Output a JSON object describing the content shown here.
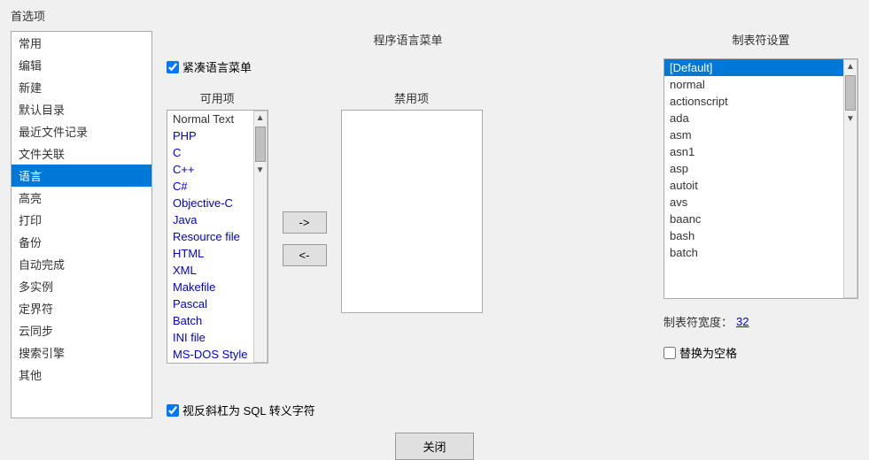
{
  "title": "首选项",
  "sidebar": {
    "items": [
      {
        "label": "常用",
        "active": false
      },
      {
        "label": "编辑",
        "active": false
      },
      {
        "label": "新建",
        "active": false
      },
      {
        "label": "默认目录",
        "active": false
      },
      {
        "label": "最近文件记录",
        "active": false
      },
      {
        "label": "文件关联",
        "active": false
      },
      {
        "label": "语言",
        "active": true
      },
      {
        "label": "高亮",
        "active": false
      },
      {
        "label": "打印",
        "active": false
      },
      {
        "label": "备份",
        "active": false
      },
      {
        "label": "自动完成",
        "active": false
      },
      {
        "label": "多实例",
        "active": false
      },
      {
        "label": "定界符",
        "active": false
      },
      {
        "label": "云同步",
        "active": false
      },
      {
        "label": "搜索引擎",
        "active": false
      },
      {
        "label": "其他",
        "active": false
      }
    ]
  },
  "center": {
    "panel_title": "程序语言菜单",
    "compact_lang_label": "紧凑语言菜单",
    "compact_lang_checked": true,
    "available_title": "可用项",
    "disabled_title": "禁用项",
    "arrow_right": "->",
    "arrow_left": "<-",
    "available_items": [
      {
        "label": "Normal Text",
        "colored": false
      },
      {
        "label": "PHP",
        "colored": true
      },
      {
        "label": "C",
        "colored": true
      },
      {
        "label": "C++",
        "colored": true
      },
      {
        "label": "C#",
        "colored": true
      },
      {
        "label": "Objective-C",
        "colored": true
      },
      {
        "label": "Java",
        "colored": true
      },
      {
        "label": "Resource file",
        "colored": true
      },
      {
        "label": "HTML",
        "colored": true
      },
      {
        "label": "XML",
        "colored": true
      },
      {
        "label": "Makefile",
        "colored": true
      },
      {
        "label": "Pascal",
        "colored": true
      },
      {
        "label": "Batch",
        "colored": true
      },
      {
        "label": "INI file",
        "colored": true
      },
      {
        "label": "MS-DOS Style",
        "colored": true
      }
    ],
    "sql_checkbox_label": "视反斜杠为 SQL 转义字符",
    "sql_checkbox_checked": true
  },
  "right": {
    "panel_title": "制表符设置",
    "list_items": [
      {
        "label": "[Default]",
        "selected": true
      },
      {
        "label": "normal",
        "selected": false
      },
      {
        "label": "actionscript",
        "selected": false
      },
      {
        "label": "ada",
        "selected": false
      },
      {
        "label": "asm",
        "selected": false
      },
      {
        "label": "asn1",
        "selected": false
      },
      {
        "label": "asp",
        "selected": false
      },
      {
        "label": "autoit",
        "selected": false
      },
      {
        "label": "avs",
        "selected": false
      },
      {
        "label": "baanc",
        "selected": false
      },
      {
        "label": "bash",
        "selected": false
      },
      {
        "label": "batch",
        "selected": false
      }
    ],
    "tab_width_label": "制表符宽度：",
    "tab_width_value": "32",
    "replace_checkbox_label": "替换为空格",
    "replace_checkbox_checked": false
  },
  "footer": {
    "close_label": "关闭"
  }
}
